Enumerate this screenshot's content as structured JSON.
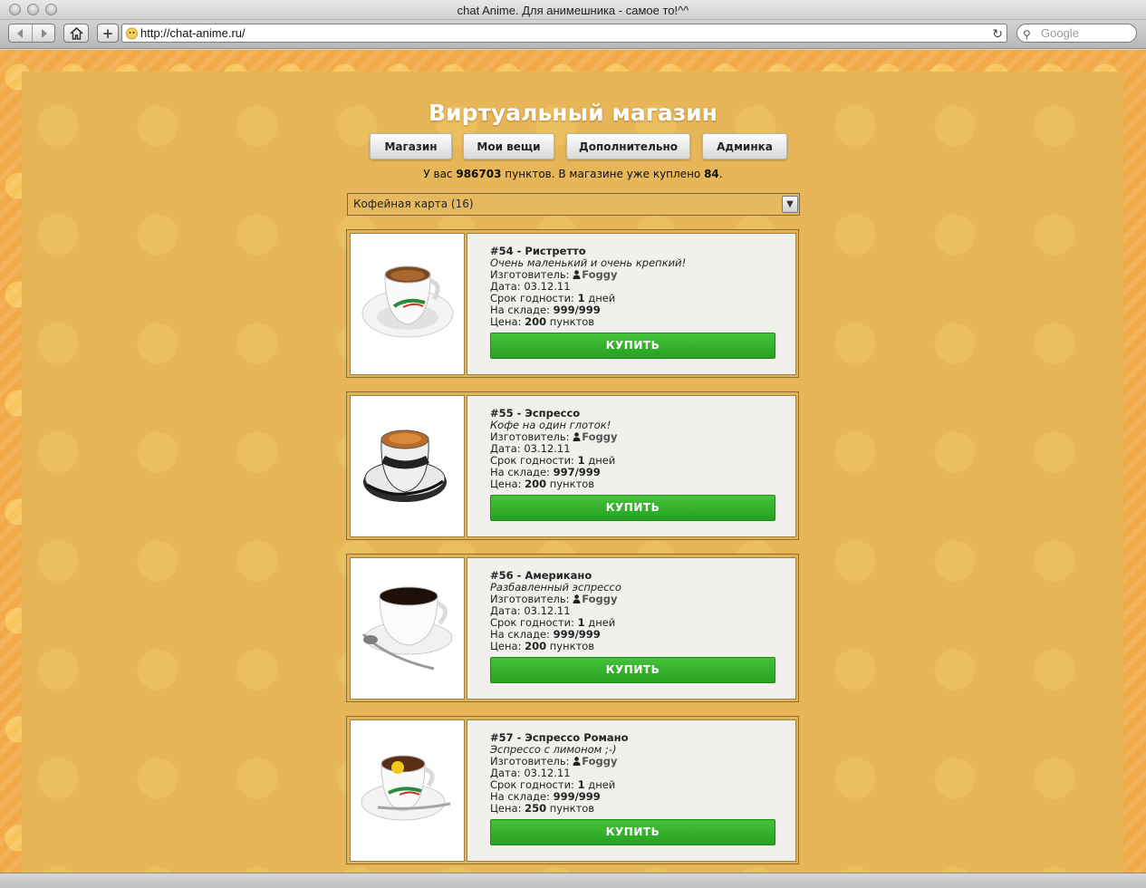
{
  "browser": {
    "window_title": "chat Anime. Для анимешника - самое то!^^",
    "url": "http://chat-anime.ru/",
    "search_placeholder": "Google",
    "add_label": "+"
  },
  "shop": {
    "title": "Виртуальный магазин",
    "nav": [
      "Магазин",
      "Мои вещи",
      "Дополнительно",
      "Админка"
    ],
    "balance": {
      "prefix": "У вас",
      "points": "986703",
      "middle": "пунктов. В магазине уже куплено",
      "bought": "84",
      "suffix": "."
    },
    "category": "Кофейная карта (16)"
  },
  "labels": {
    "maker": "Изготовитель:",
    "date": "Дата:",
    "shelf_life": "Срок годности:",
    "days": "дней",
    "stock": "На складе:",
    "price": "Цена:",
    "points": "пунктов",
    "buy": "КУПИТЬ"
  },
  "items": [
    {
      "name": "#54 - Ристретто",
      "desc": "Очень маленький и очень крепкий!",
      "maker": "Foggy",
      "date": "03.12.11",
      "shelf": "1",
      "stock": "999/999",
      "price": "200",
      "image": "espresso-cup-white"
    },
    {
      "name": "#55 - Эспрессо",
      "desc": "Кофе на один глоток!",
      "maker": "Foggy",
      "date": "03.12.11",
      "shelf": "1",
      "stock": "997/999",
      "price": "200",
      "image": "espresso-cup-printed"
    },
    {
      "name": "#56 - Американо",
      "desc": "Разбавленный эспрессо",
      "maker": "Foggy",
      "date": "03.12.11",
      "shelf": "1",
      "stock": "999/999",
      "price": "200",
      "image": "black-coffee-cup"
    },
    {
      "name": "#57 - Эспрессо Романо",
      "desc": "Эспрессо с лимоном ;-)",
      "maker": "Foggy",
      "date": "03.12.11",
      "shelf": "1",
      "stock": "999/999",
      "price": "250",
      "image": "espresso-lemon-cup"
    }
  ],
  "colors": {
    "buy_button": "#33b02c",
    "background": "#f2a94a",
    "panel": "#e6b658"
  }
}
